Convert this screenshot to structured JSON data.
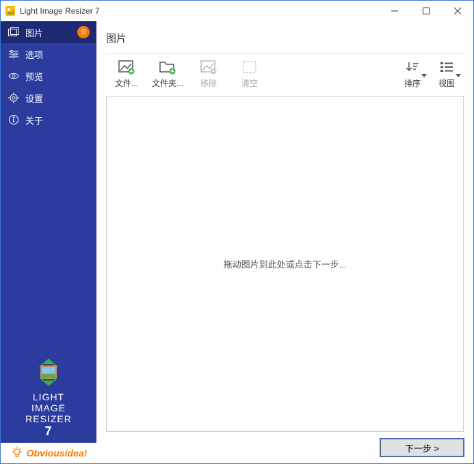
{
  "window": {
    "title": "Light Image Resizer 7"
  },
  "sidebar": {
    "items": [
      {
        "label": "图片",
        "badge": "0"
      },
      {
        "label": "选项"
      },
      {
        "label": "预览"
      },
      {
        "label": "设置"
      },
      {
        "label": "关于"
      }
    ],
    "logo": {
      "line1": "LIGHT",
      "line2": "IMAGE",
      "line3": "RESIZER",
      "version": "7"
    },
    "brand": "Obviousidea!"
  },
  "main": {
    "title": "图片",
    "toolbar": {
      "files": "文件...",
      "folder": "文件夹...",
      "remove": "移除",
      "clear": "清空",
      "sort": "排序",
      "view": "视图"
    },
    "dropzone_hint": "拖动图片到此处或点击下一步...",
    "next_label": "下一步 >"
  }
}
